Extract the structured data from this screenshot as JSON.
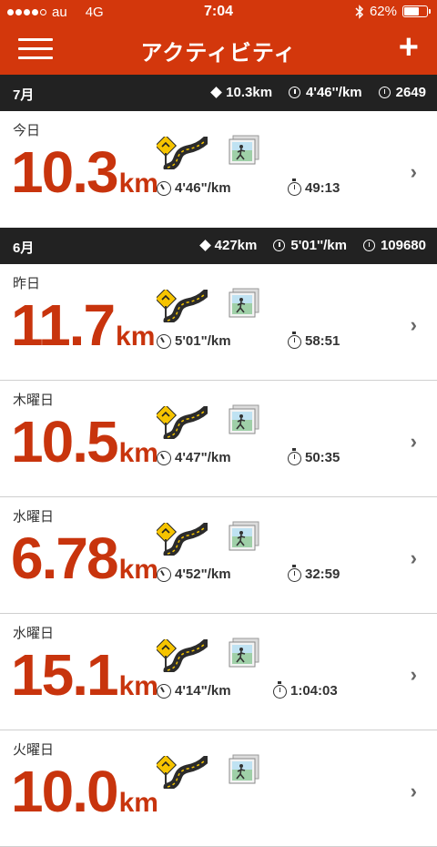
{
  "status": {
    "carrier": "au",
    "network": "4G",
    "time": "7:04",
    "battery": "62%",
    "signal_bars": 5,
    "signal_filled": 4,
    "battery_level": 0.62
  },
  "nav": {
    "title": "アクティビティ",
    "menu_icon": "hamburger-icon",
    "add_icon": "plus-icon"
  },
  "colors": {
    "accent": "#d3370c",
    "distance": "#c8340d",
    "header_bg": "#222222"
  },
  "sections": [
    {
      "month": "7月",
      "stats": {
        "distance": "10.3km",
        "pace": "4'46''/km",
        "fuel": "2649"
      },
      "activities": [
        {
          "day": "今日",
          "distance": "10.3",
          "unit": "km",
          "pace": "4'46\"/km",
          "duration": "49:13"
        }
      ]
    },
    {
      "month": "6月",
      "stats": {
        "distance": "427km",
        "pace": "5'01''/km",
        "fuel": "109680"
      },
      "activities": [
        {
          "day": "昨日",
          "distance": "11.7",
          "unit": "km",
          "pace": "5'01\"/km",
          "duration": "58:51"
        },
        {
          "day": "木曜日",
          "distance": "10.5",
          "unit": "km",
          "pace": "4'47\"/km",
          "duration": "50:35"
        },
        {
          "day": "水曜日",
          "distance": "6.78",
          "unit": "km",
          "pace": "4'52\"/km",
          "duration": "32:59"
        },
        {
          "day": "水曜日",
          "distance": "15.1",
          "unit": "km",
          "pace": "4'14\"/km",
          "duration": "1:04:03"
        },
        {
          "day": "火曜日",
          "distance": "10.0",
          "unit": "km",
          "pace": "",
          "duration": ""
        }
      ]
    }
  ]
}
